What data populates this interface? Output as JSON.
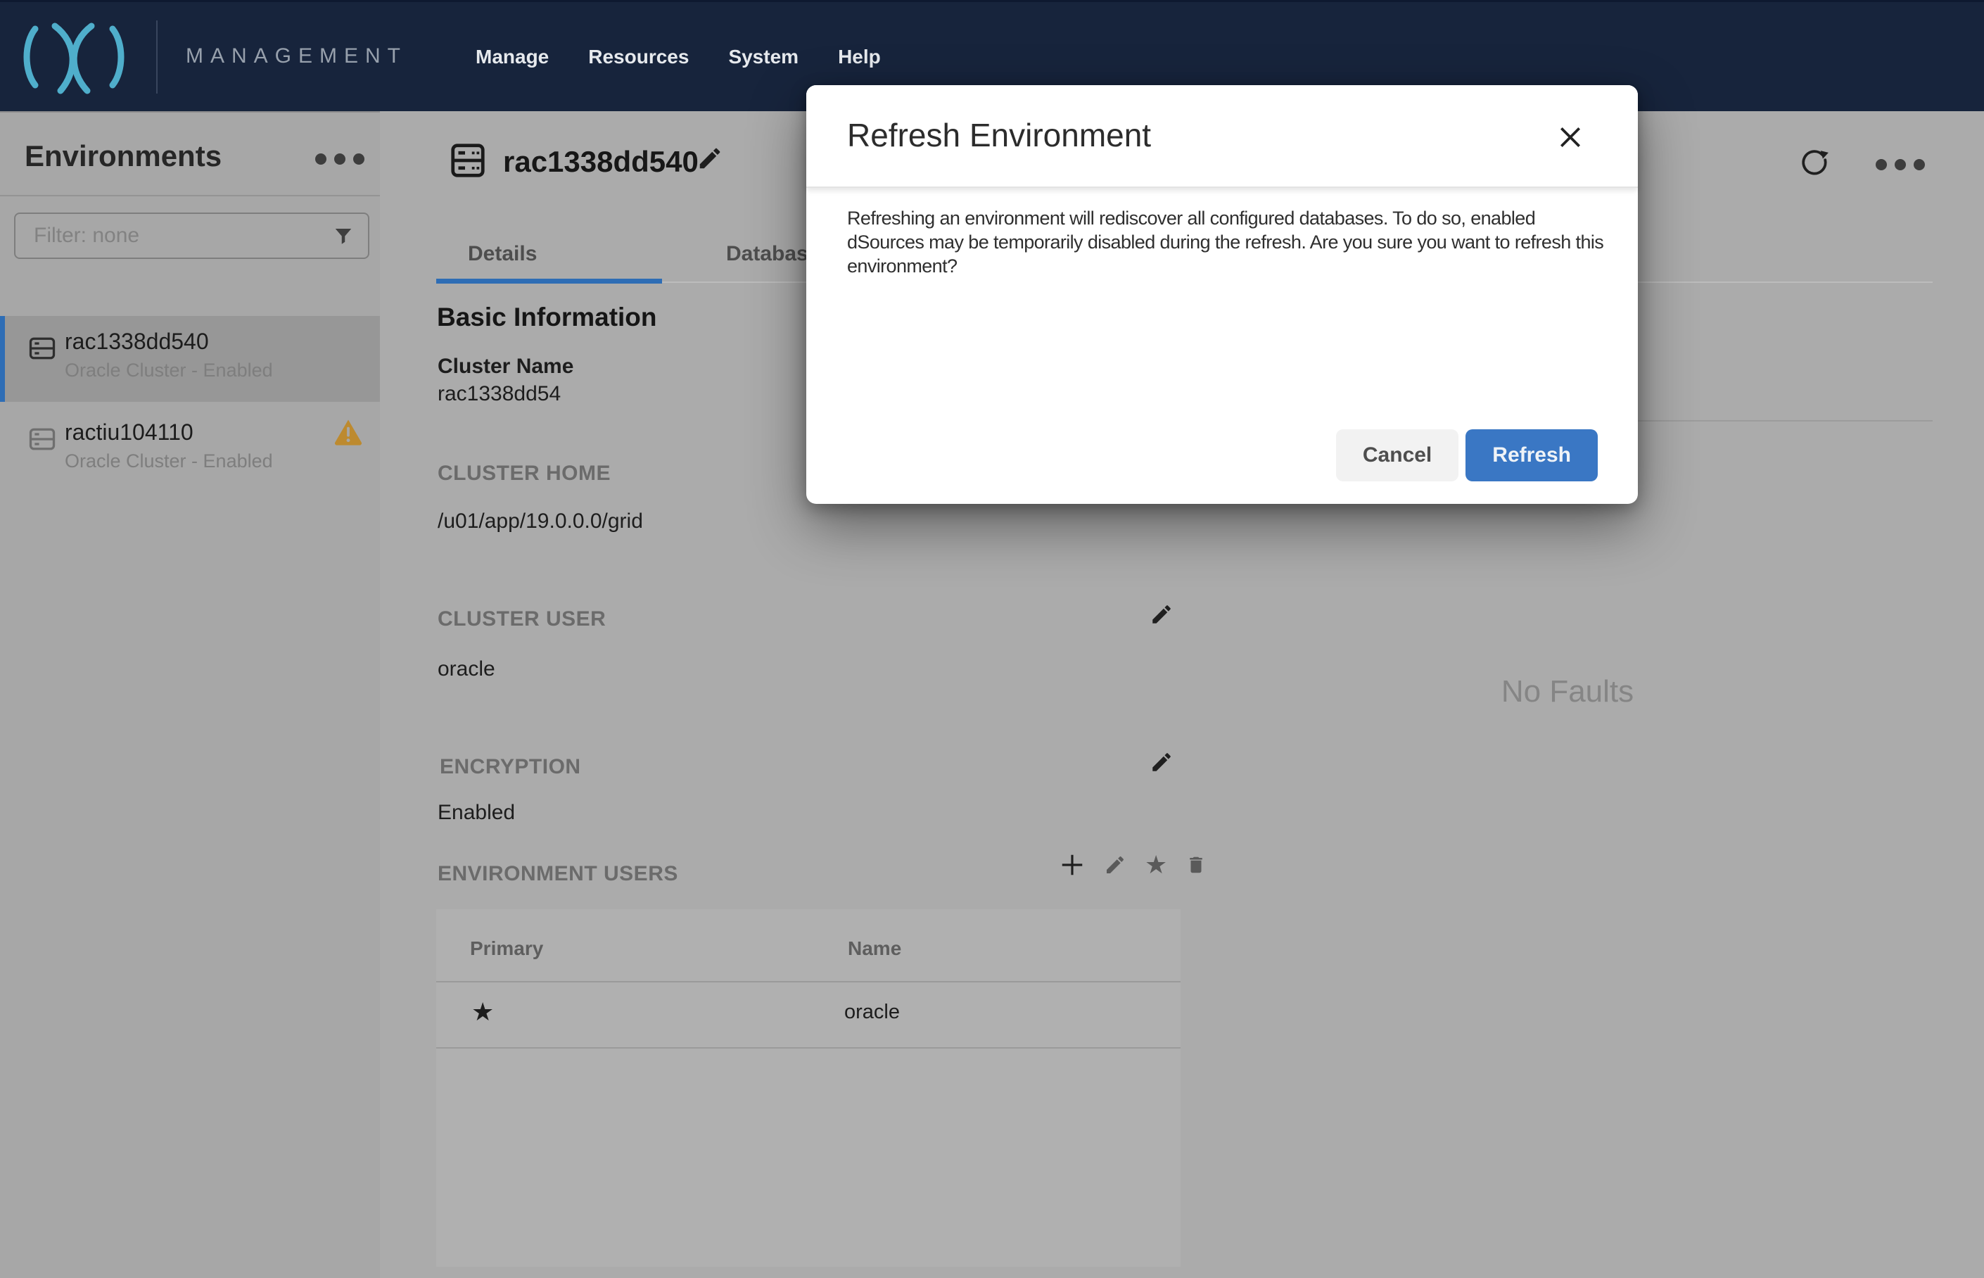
{
  "nav": {
    "brand": "MANAGEMENT",
    "items": [
      {
        "label": "Manage"
      },
      {
        "label": "Resources"
      },
      {
        "label": "System"
      },
      {
        "label": "Help"
      }
    ]
  },
  "sidebar": {
    "title": "Environments",
    "filter_placeholder": "Filter: none",
    "environments": [
      {
        "name": "rac1338dd540",
        "status": "Oracle Cluster - Enabled",
        "selected": true
      },
      {
        "name": "ractiu104110",
        "status": "Oracle Cluster - Enabled",
        "warning": true
      }
    ]
  },
  "content": {
    "title": "rac1338dd540",
    "tabs": [
      {
        "label": "Details",
        "active": true
      },
      {
        "label": "Databases"
      }
    ],
    "section_heading": "Basic Information",
    "cluster_name_label": "Cluster Name",
    "cluster_name_value": "rac1338dd54",
    "cluster_home_label": "CLUSTER HOME",
    "cluster_home_value": "/u01/app/19.0.0.0/grid",
    "cluster_user_label": "CLUSTER USER",
    "cluster_user_value": "oracle",
    "encryption_label": "ENCRYPTION",
    "encryption_value": "Enabled",
    "env_users": {
      "heading": "ENVIRONMENT USERS",
      "columns": [
        "Primary",
        "Name"
      ],
      "rows": [
        {
          "primary_icon": "★",
          "name": "oracle"
        }
      ]
    },
    "faults_placeholder": "No Faults"
  },
  "modal": {
    "title": "Refresh Environment",
    "body": "Refreshing an environment will rediscover all configured databases. To do so, enabled dSources may be temporarily disabled during the refresh. Are you sure you want to refresh this environment?",
    "cancel_label": "Cancel",
    "confirm_label": "Refresh"
  },
  "colors": {
    "nav_navy": "#17243C",
    "accent_blue": "#2E6DB5",
    "button_blue": "#3A77C4",
    "warning_amber": "#BD8A2F",
    "logo_teal": "#4FAECB"
  }
}
